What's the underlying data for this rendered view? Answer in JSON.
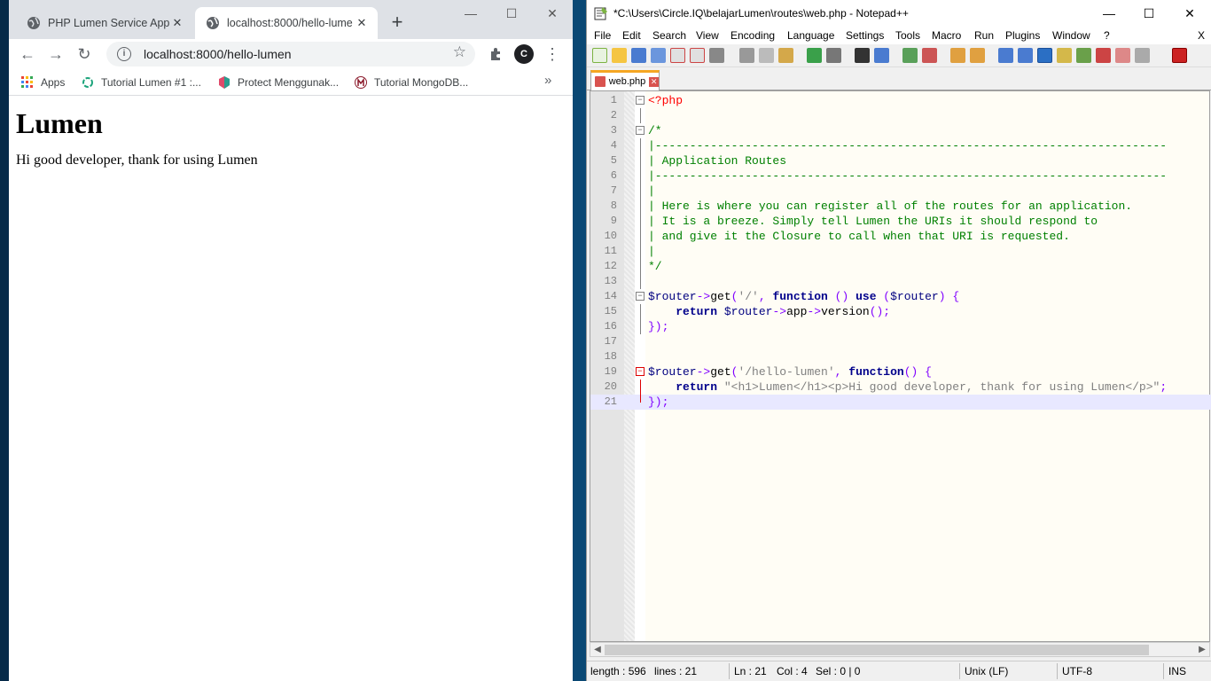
{
  "browser": {
    "tabs": [
      {
        "title": "PHP Lumen Service App.p",
        "active": false
      },
      {
        "title": "localhost:8000/hello-lume",
        "active": true
      }
    ],
    "url": "localhost:8000/hello-lumen",
    "avatar_letter": "C",
    "bookmarks": [
      {
        "label": "Apps",
        "icon": "apps-grid-icon"
      },
      {
        "label": "Tutorial Lumen #1 :...",
        "icon": "lumen-bookmark-icon"
      },
      {
        "label": "Protect Menggunak...",
        "icon": "shield-bookmark-icon"
      },
      {
        "label": "Tutorial MongoDB...",
        "icon": "mongodb-bookmark-icon"
      }
    ],
    "page": {
      "heading": "Lumen",
      "paragraph": "Hi good developer, thank for using Lumen"
    }
  },
  "editor": {
    "title": "*C:\\Users\\Circle.IQ\\belajarLumen\\routes\\web.php - Notepad++",
    "menu": [
      "File",
      "Edit",
      "Search",
      "View",
      "Encoding",
      "Language",
      "Settings",
      "Tools",
      "Macro",
      "Run",
      "Plugins",
      "Window",
      "?"
    ],
    "close_x": "X",
    "file_tab": "web.php",
    "status": {
      "length": "length : 596",
      "lines": "lines : 21",
      "ln": "Ln : 21",
      "col": "Col : 4",
      "sel": "Sel : 0 | 0",
      "eol": "Unix (LF)",
      "encoding": "UTF-8",
      "mode": "INS"
    },
    "line_numbers": [
      "1",
      "2",
      "3",
      "4",
      "5",
      "6",
      "7",
      "8",
      "9",
      "10",
      "11",
      "12",
      "13",
      "14",
      "15",
      "16",
      "17",
      "18",
      "19",
      "20",
      "21"
    ],
    "code": {
      "l1": "<?php",
      "l3": "/*",
      "l4": "|--------------------------------------------------------------------------",
      "l5": "| Application Routes",
      "l6": "|--------------------------------------------------------------------------",
      "l7": "|",
      "l8": "| Here is where you can register all of the routes for an application.",
      "l9": "| It is a breeze. Simply tell Lumen the URIs it should respond to",
      "l10": "| and give it the Closure to call when that URI is requested.",
      "l11": "|",
      "l12": "*/",
      "l14": [
        "$router",
        "->",
        "get",
        "(",
        "'/'",
        ", ",
        "function",
        " () ",
        "use",
        " (",
        "$router",
        ") {"
      ],
      "l15": [
        "    ",
        "return",
        " ",
        "$router",
        "->",
        "app",
        "->",
        "version",
        "();"
      ],
      "l16": "});",
      "l19": [
        "$router",
        "->",
        "get",
        "(",
        "'/hello-lumen'",
        ", ",
        "function",
        "() {"
      ],
      "l20": [
        "    ",
        "return",
        " ",
        "\"<h1>Lumen</h1><p>Hi good developer, thank for using Lumen</p>\"",
        ";"
      ],
      "l21": "});"
    }
  }
}
